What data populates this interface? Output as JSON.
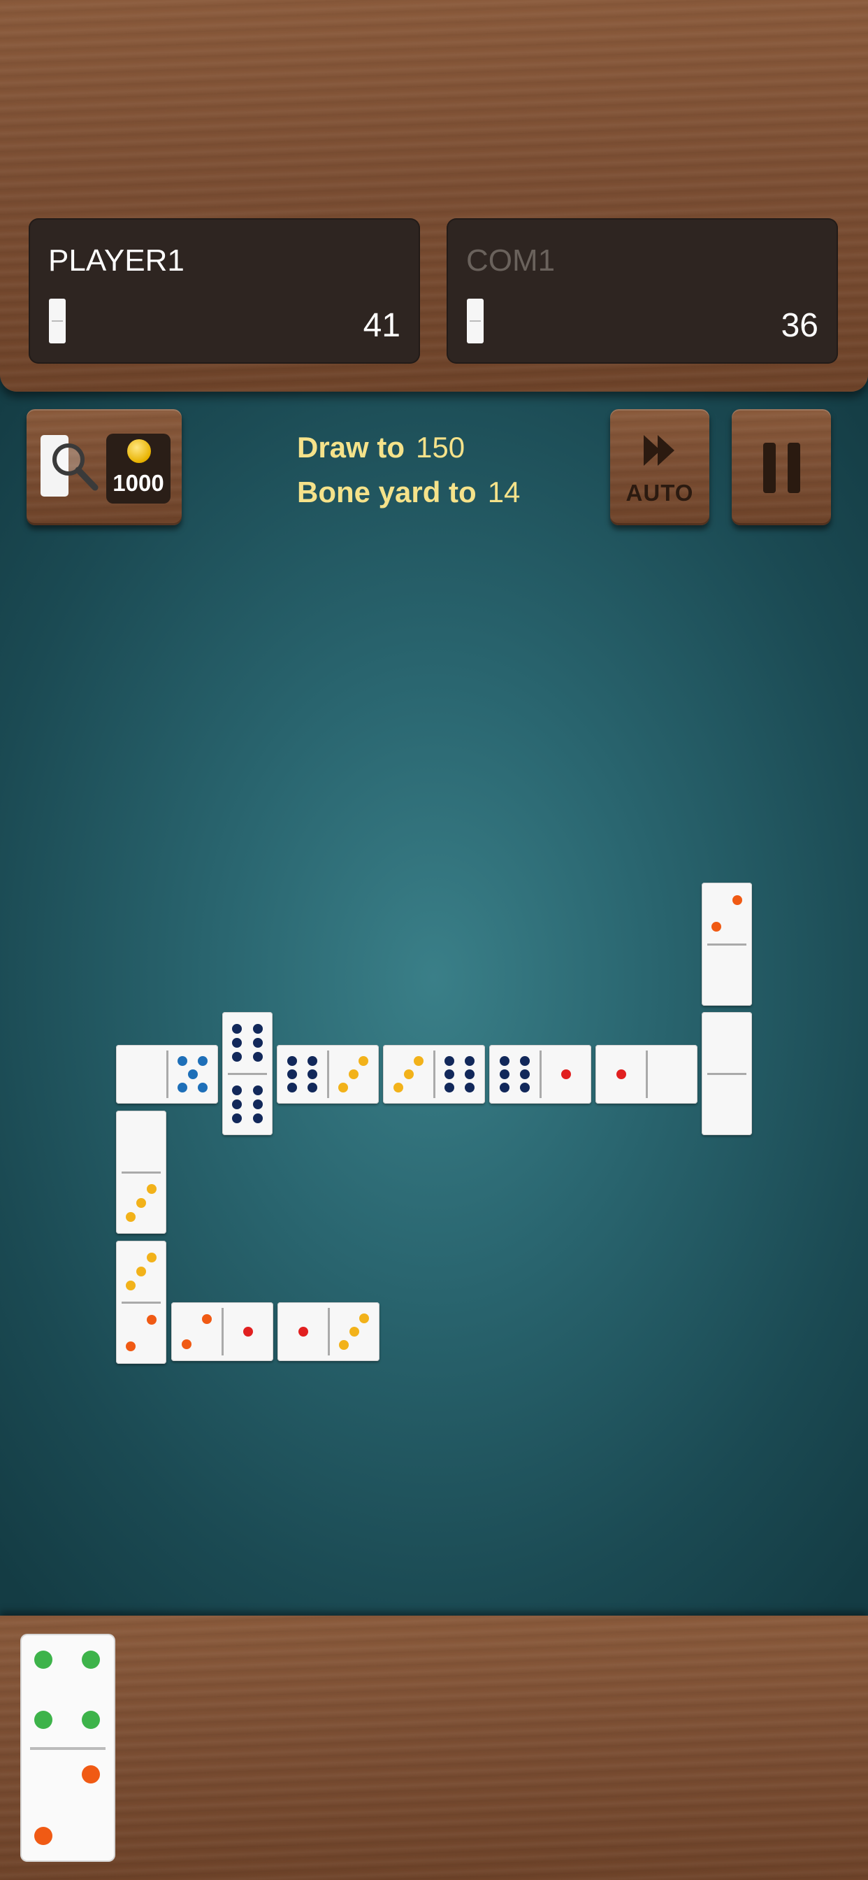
{
  "players": [
    {
      "name": "PLAYER1",
      "score": "41"
    },
    {
      "name": "COM1",
      "score": "36"
    }
  ],
  "coins": "1000",
  "game": {
    "draw_to_label": "Draw to",
    "draw_to_value": "150",
    "boneyard_label": "Bone yard to",
    "boneyard_value": "14"
  },
  "buttons": {
    "auto_label": "AUTO"
  },
  "icons": [
    "coin-icon",
    "card-icon",
    "magnifier-icon",
    "fast-forward-icon",
    "pause-icon"
  ],
  "colors": {
    "felt": "#2a6670",
    "wood": "#7a4d32",
    "panel": "#2e2521",
    "label_yellow": "#f5e28a",
    "pip_red": "#e12020",
    "pip_orange": "#f05a14",
    "pip_yellow": "#f2b21a",
    "pip_blue": "#1e6fb8",
    "pip_navy": "#12285a",
    "pip_green": "#3db34a"
  },
  "board_tiles": [
    {
      "id": "t1",
      "orientation": "horizontal",
      "pips": [
        0,
        5
      ]
    },
    {
      "id": "t2",
      "orientation": "vertical",
      "pips": [
        6,
        6
      ]
    },
    {
      "id": "t3",
      "orientation": "horizontal",
      "pips": [
        6,
        3
      ]
    },
    {
      "id": "t4",
      "orientation": "horizontal",
      "pips": [
        3,
        6
      ]
    },
    {
      "id": "t5",
      "orientation": "horizontal",
      "pips": [
        6,
        1
      ]
    },
    {
      "id": "t6",
      "orientation": "horizontal",
      "pips": [
        1,
        0
      ]
    },
    {
      "id": "t7",
      "orientation": "vertical",
      "pips": [
        0,
        0
      ]
    },
    {
      "id": "t8",
      "orientation": "vertical",
      "pips": [
        2,
        0
      ]
    },
    {
      "id": "t9",
      "orientation": "vertical",
      "pips": [
        0,
        3
      ]
    },
    {
      "id": "t10",
      "orientation": "vertical",
      "pips": [
        3,
        2
      ]
    },
    {
      "id": "t11",
      "orientation": "horizontal",
      "pips": [
        2,
        1
      ]
    },
    {
      "id": "t12",
      "orientation": "horizontal",
      "pips": [
        1,
        3
      ]
    }
  ],
  "hand_tiles": [
    {
      "id": "h1",
      "pips": [
        4,
        2
      ]
    }
  ]
}
